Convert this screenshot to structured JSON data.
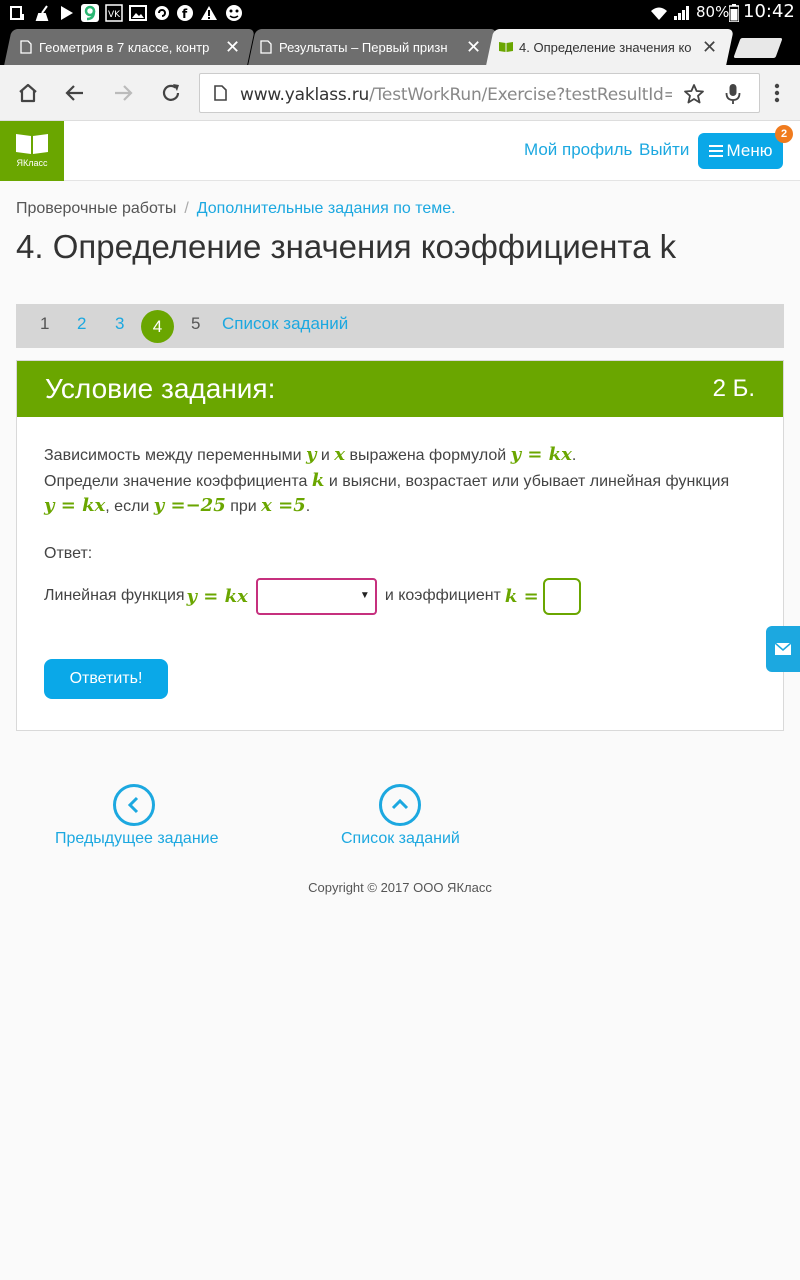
{
  "status_bar": {
    "battery": "80%",
    "time": "10:42"
  },
  "tabs": [
    {
      "title": "Геометрия в 7 классе, контр",
      "active": false
    },
    {
      "title": "Результаты – Первый призн",
      "active": false
    },
    {
      "title": "4. Определение значения ко",
      "active": true
    }
  ],
  "toolbar": {
    "url_host": "www.yaklass.ru",
    "url_path": "/TestWorkRun/Exercise?testResultId="
  },
  "header": {
    "logo_label": "ЯКласс",
    "profile_link": "Мой профиль",
    "logout_link": "Выйти",
    "menu_label": "Меню",
    "menu_badge": "2"
  },
  "breadcrumb": {
    "root": "Проверочные работы",
    "separator": "/",
    "current": "Дополнительные задания по теме."
  },
  "page_title": "4. Определение значения коэффициента k",
  "pager": {
    "items": [
      "1",
      "2",
      "3",
      "4",
      "5"
    ],
    "current": "4",
    "list_link": "Список заданий"
  },
  "task": {
    "heading": "Условие задания:",
    "points": "2 Б.",
    "line1": {
      "t1": "Зависимость между переменными ",
      "m1": "y",
      "t2": " и ",
      "m2": "x",
      "t3": " выражена формулой ",
      "m3": "y = kx",
      "t4": "."
    },
    "line2": {
      "t1": "Определи значение коэффициента ",
      "m1": "k",
      "t2": " и выясни, возрастает или убывает линейная функция"
    },
    "line3": {
      "m1": "y = kx",
      "t1": ", если ",
      "m2": "y =−25",
      "t2": " при ",
      "m3": "x =5",
      "t3": "."
    },
    "answer_label": "Ответ:",
    "answer_row": {
      "t1": "Линейная функция ",
      "m1": "y = kx",
      "select_value": "",
      "t2": " и  коэффициент ",
      "m2": "k ="
    },
    "submit_label": "Ответить!"
  },
  "nav": {
    "prev_label": "Предыдущее задание",
    "list_label": "Список заданий"
  },
  "copyright": "Copyright © 2017 ООО ЯКласс",
  "colors": {
    "brand_green": "#6aa600",
    "link_blue": "#1ca8e0",
    "button_blue": "#0aa8e8",
    "select_border": "#c6307e",
    "badge_orange": "#f07b1e"
  }
}
